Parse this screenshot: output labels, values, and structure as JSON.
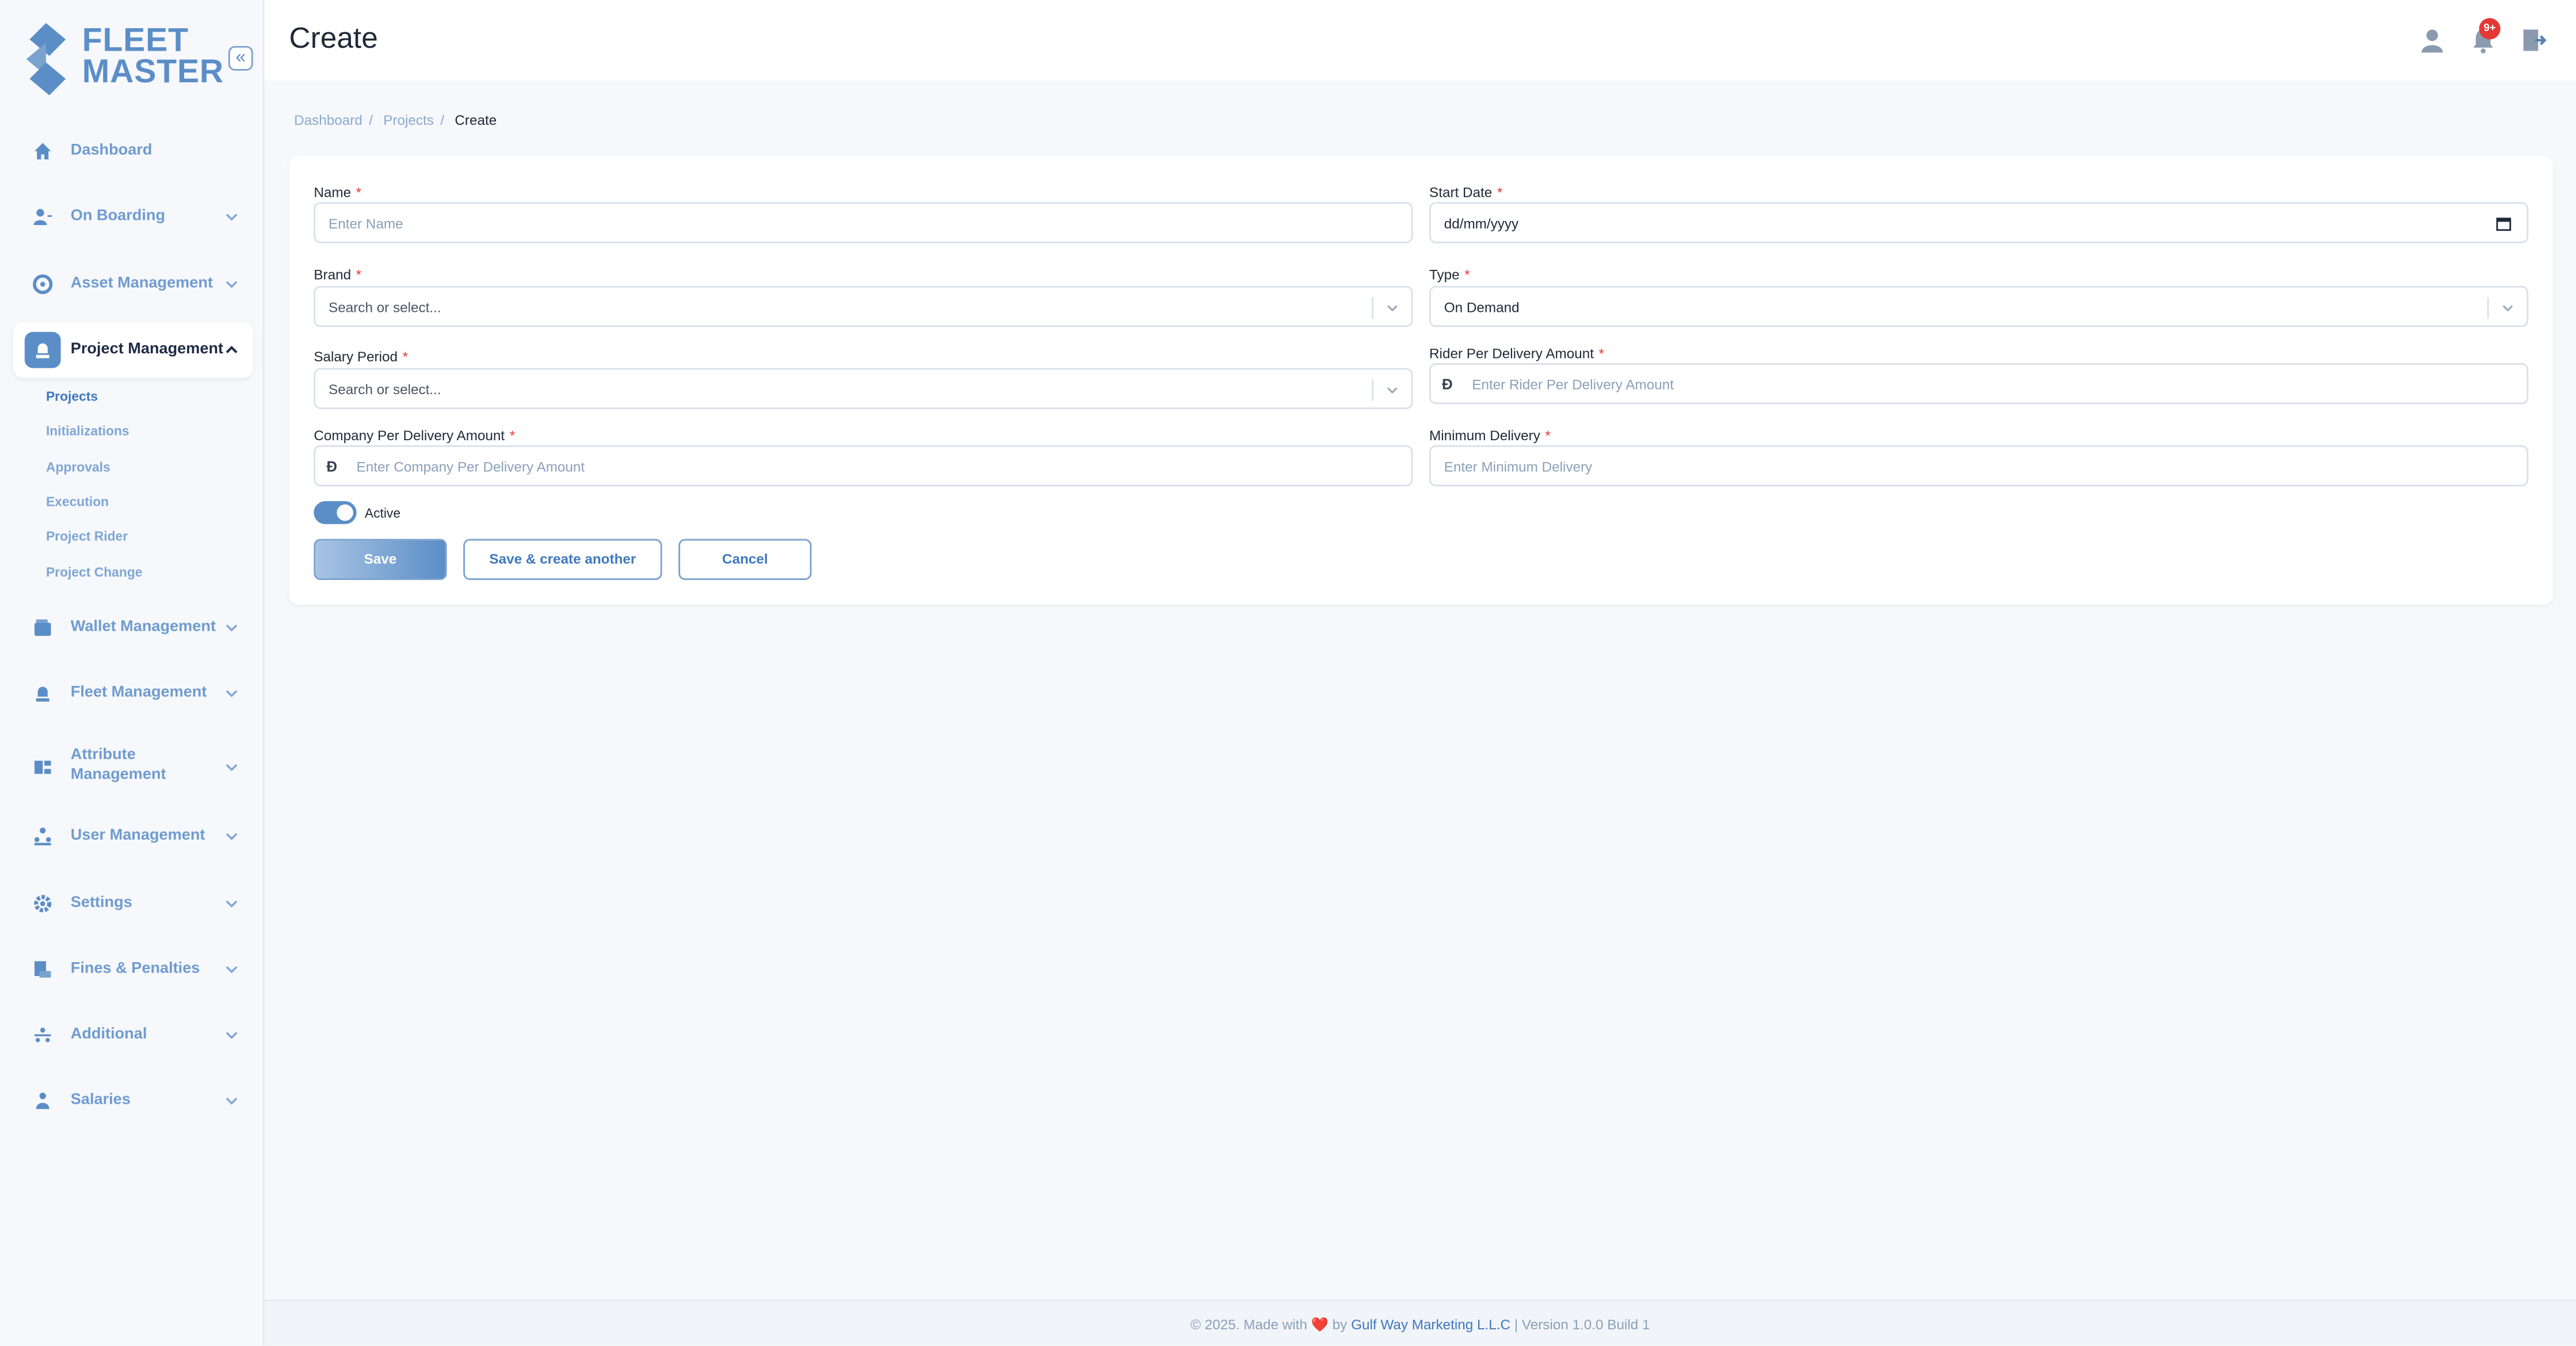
{
  "brand": {
    "line1": "FLEET",
    "line2": "MASTER",
    "collapse_glyph": "«"
  },
  "sidebar": {
    "items": [
      {
        "label": "Dashboard",
        "icon": "home-icon"
      },
      {
        "label": "On Boarding",
        "icon": "user-plus-icon"
      },
      {
        "label": "Asset Management",
        "icon": "asset-icon"
      },
      {
        "label": "Project Management",
        "icon": "project-icon",
        "active": true
      },
      {
        "label": "Wallet Management",
        "icon": "wallet-icon"
      },
      {
        "label": "Fleet Management",
        "icon": "fleet-icon"
      },
      {
        "label": "Attribute Management",
        "icon": "attribute-icon"
      },
      {
        "label": "User Management",
        "icon": "users-icon"
      },
      {
        "label": "Settings",
        "icon": "gear-icon"
      },
      {
        "label": "Fines & Penalties",
        "icon": "fines-icon"
      },
      {
        "label": "Additional",
        "icon": "additional-icon"
      },
      {
        "label": "Salaries",
        "icon": "salaries-icon"
      }
    ],
    "sub_items": [
      "Projects",
      "Initializations",
      "Approvals",
      "Execution",
      "Project Rider",
      "Project Change"
    ]
  },
  "header": {
    "title": "Create",
    "notification_count": "9+"
  },
  "breadcrumb": [
    "Dashboard",
    "Projects",
    "Create"
  ],
  "form": {
    "name": {
      "label": "Name",
      "placeholder": "Enter Name"
    },
    "start_date": {
      "label": "Start Date",
      "value": "dd/mm/yyyy"
    },
    "brand": {
      "label": "Brand",
      "placeholder": "Search or select..."
    },
    "type": {
      "label": "Type",
      "value": "On Demand"
    },
    "salary_period": {
      "label": "Salary Period",
      "placeholder": "Search or select..."
    },
    "rider_amount": {
      "label": "Rider Per Delivery Amount",
      "placeholder": "Enter Rider Per Delivery Amount",
      "prefix": "Đ"
    },
    "company_amount": {
      "label": "Company Per Delivery Amount",
      "placeholder": "Enter Company Per Delivery Amount",
      "prefix": "Đ"
    },
    "min_delivery": {
      "label": "Minimum Delivery",
      "placeholder": "Enter Minimum Delivery"
    },
    "required_mark": "*",
    "active_label": "Active",
    "active": true
  },
  "buttons": {
    "save": "Save",
    "save_another": "Save & create another",
    "cancel": "Cancel"
  },
  "footer": {
    "prefix": "© 2025. Made with",
    "heart": "❤️",
    "by": "by",
    "company": "Gulf Way Marketing L.L.C",
    "version": "| Version 1.0.0 Build 1"
  },
  "colors": {
    "accent": "#5b8ec7",
    "required": "#e53935",
    "badge": "#e53935"
  }
}
